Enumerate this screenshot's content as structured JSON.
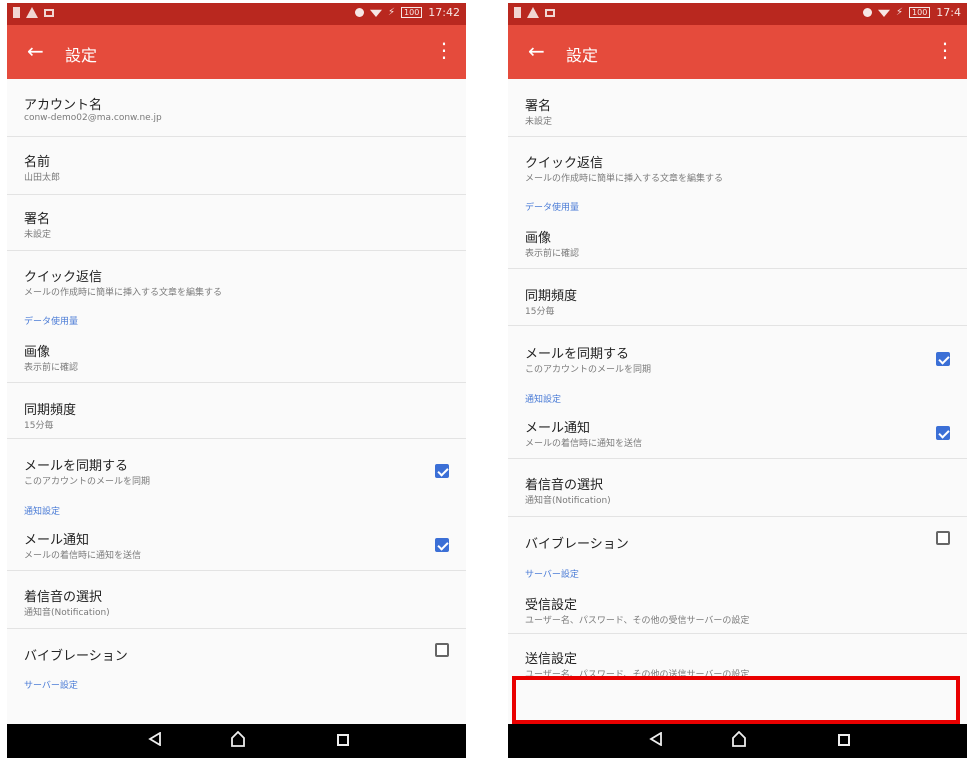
{
  "screens": {
    "left": {
      "status": {
        "battery": "100",
        "time": "17:42"
      },
      "title": "設定",
      "items": {
        "account_name": {
          "title": "アカウント名",
          "subtitle": "conw-demo02@ma.conw.ne.jp"
        },
        "name": {
          "title": "名前",
          "subtitle": "山田太郎"
        },
        "signature": {
          "title": "署名",
          "subtitle": "未設定"
        },
        "quick_reply": {
          "title": "クイック返信",
          "subtitle": "メールの作成時に簡単に挿入する文章を編集する"
        },
        "images": {
          "title": "画像",
          "subtitle": "表示前に確認"
        },
        "sync_frequency": {
          "title": "同期頻度",
          "subtitle": "15分毎"
        },
        "sync_mail": {
          "title": "メールを同期する",
          "subtitle": "このアカウントのメールを同期",
          "checked": true
        },
        "mail_notification": {
          "title": "メール通知",
          "subtitle": "メールの着信時に通知を送信",
          "checked": true
        },
        "ringtone": {
          "title": "着信音の選択",
          "subtitle": "通知音(Notification)"
        },
        "vibration": {
          "title": "バイブレーション",
          "checked": false
        }
      },
      "sections": {
        "data_usage": "データ使用量",
        "notification_settings": "通知設定",
        "server_settings": "サーバー設定"
      }
    },
    "right": {
      "status": {
        "battery": "100",
        "time": "17:4"
      },
      "title": "設定",
      "items": {
        "signature": {
          "title": "署名",
          "subtitle": "未設定"
        },
        "quick_reply": {
          "title": "クイック返信",
          "subtitle": "メールの作成時に簡単に挿入する文章を編集する"
        },
        "images": {
          "title": "画像",
          "subtitle": "表示前に確認"
        },
        "sync_frequency": {
          "title": "同期頻度",
          "subtitle": "15分毎"
        },
        "sync_mail": {
          "title": "メールを同期する",
          "subtitle": "このアカウントのメールを同期",
          "checked": true
        },
        "mail_notification": {
          "title": "メール通知",
          "subtitle": "メールの着信時に通知を送信",
          "checked": true
        },
        "ringtone": {
          "title": "着信音の選択",
          "subtitle": "通知音(Notification)"
        },
        "vibration": {
          "title": "バイブレーション",
          "checked": false
        },
        "incoming_settings": {
          "title": "受信設定",
          "subtitle": "ユーザー名、パスワード、その他の受信サーバーの設定"
        },
        "outgoing_settings": {
          "title": "送信設定",
          "subtitle": "ユーザー名、パスワード、その他の送信サーバーの設定"
        }
      },
      "sections": {
        "data_usage": "データ使用量",
        "notification_settings": "通知設定",
        "server_settings": "サーバー設定"
      }
    }
  },
  "colors": {
    "statusbar": "#b9281f",
    "toolbar": "#e54b3c",
    "section_label": "#4a7bd6",
    "checkbox": "#3b6fd6",
    "highlight": "#e90000"
  },
  "icons": [
    "back-arrow-icon",
    "more-vert-icon",
    "nav-back-icon",
    "nav-home-icon",
    "nav-recent-icon"
  ]
}
